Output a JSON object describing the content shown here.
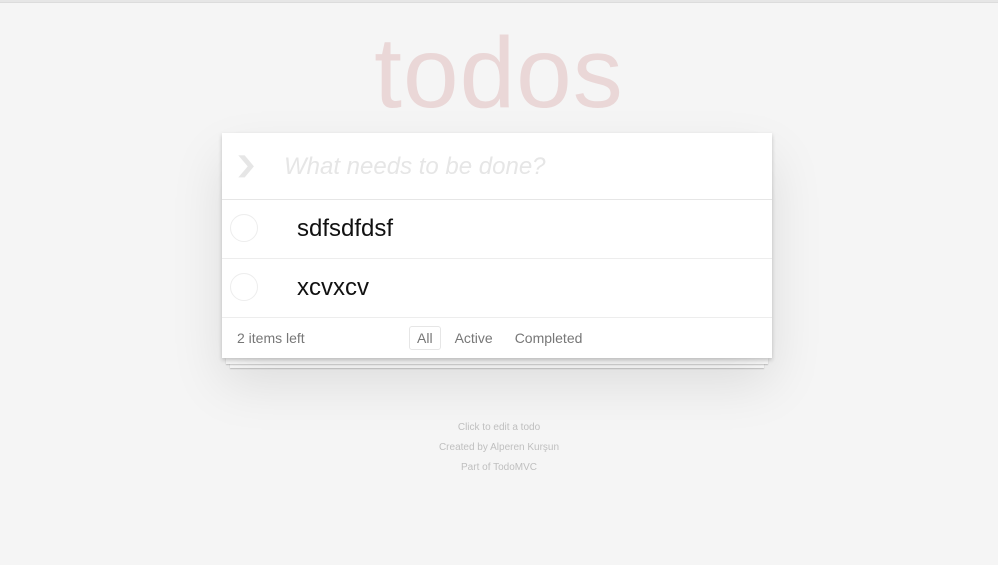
{
  "app": {
    "title": "todos"
  },
  "new_todo": {
    "placeholder": "What needs to be done?",
    "value": ""
  },
  "toggle_all_icon": "chevron-down-icon",
  "todos": [
    {
      "label": "sdfsdfdsf",
      "completed": false
    },
    {
      "label": "xcvxcv",
      "completed": false
    }
  ],
  "footer": {
    "count_text": "2 items left",
    "filters": [
      "All",
      "Active",
      "Completed"
    ],
    "selected_filter": "All"
  },
  "info": {
    "line1": "Click to edit a todo",
    "line2_prefix": "Created by ",
    "author": "Alperen Kurşun",
    "line3_prefix": "Part of ",
    "project": "TodoMVC"
  },
  "colors": {
    "background": "#f5f5f5",
    "title": "#af2f2f",
    "text": "#4d4d4d"
  }
}
